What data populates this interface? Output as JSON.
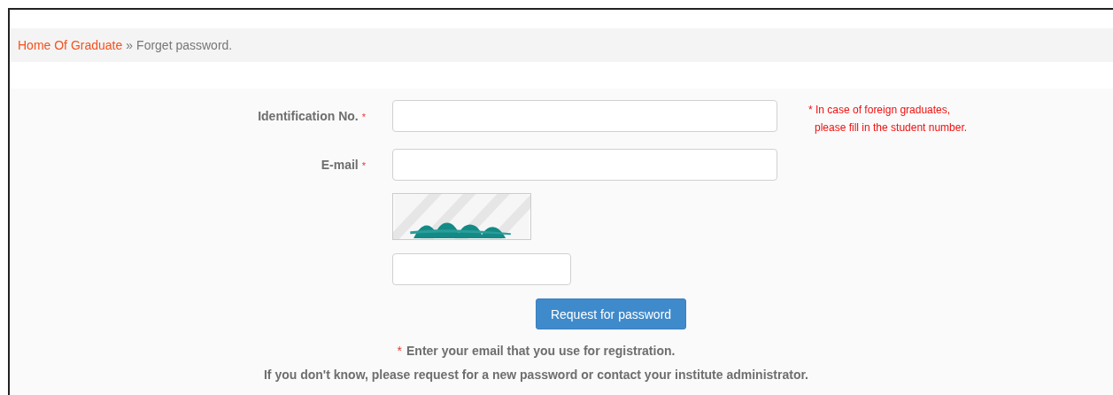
{
  "breadcrumb": {
    "home": "Home Of Graduate",
    "separator": "»",
    "current": "Forget password."
  },
  "fields": [
    {
      "label": "Identification No.",
      "required_mark": "*",
      "kind": "text",
      "note_lines": [
        "* In case of foreign graduates,",
        "please fill in the student number."
      ]
    },
    {
      "label": "E-mail",
      "required_mark": "*",
      "kind": "text"
    },
    {
      "kind": "captcha"
    },
    {
      "kind": "captcha_input"
    }
  ],
  "submit": "Request for password",
  "footer": {
    "mark": "*",
    "lines": [
      "Enter your email that you use for registration.",
      "If you don't know, please request for a new password or contact your institute administrator."
    ]
  }
}
